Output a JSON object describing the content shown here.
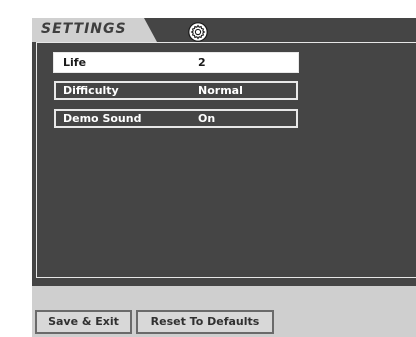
{
  "header": {
    "tab_label": "SETTINGS",
    "icon": "gear-icon"
  },
  "settings": [
    {
      "label": "Life",
      "value": "2",
      "selected": true
    },
    {
      "label": "Difficulty",
      "value": "Normal",
      "selected": false
    },
    {
      "label": "Demo Sound",
      "value": "On",
      "selected": false
    }
  ],
  "footer": {
    "save_exit_label": "Save & Exit",
    "reset_label": "Reset To Defaults"
  },
  "colors": {
    "frame": "#454545",
    "tab": "#d0d0d0",
    "bottom_bar": "#cfcfcf",
    "selected_row": "#ffffff"
  }
}
